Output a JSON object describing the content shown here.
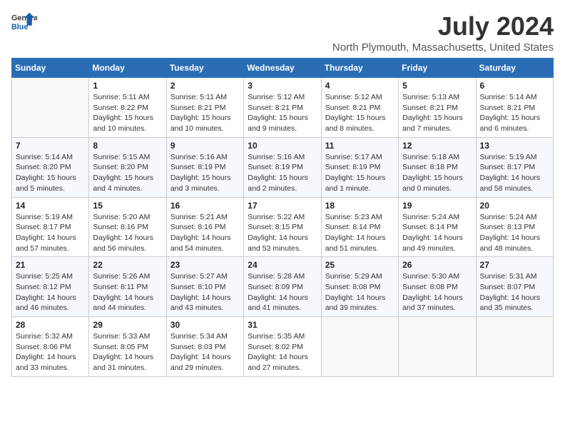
{
  "logo": {
    "line1": "General",
    "line2": "Blue"
  },
  "title": "July 2024",
  "subtitle": "North Plymouth, Massachusetts, United States",
  "weekdays": [
    "Sunday",
    "Monday",
    "Tuesday",
    "Wednesday",
    "Thursday",
    "Friday",
    "Saturday"
  ],
  "weeks": [
    [
      {
        "num": "",
        "sunrise": "",
        "sunset": "",
        "daylight": ""
      },
      {
        "num": "1",
        "sunrise": "Sunrise: 5:11 AM",
        "sunset": "Sunset: 8:22 PM",
        "daylight": "Daylight: 15 hours and 10 minutes."
      },
      {
        "num": "2",
        "sunrise": "Sunrise: 5:11 AM",
        "sunset": "Sunset: 8:21 PM",
        "daylight": "Daylight: 15 hours and 10 minutes."
      },
      {
        "num": "3",
        "sunrise": "Sunrise: 5:12 AM",
        "sunset": "Sunset: 8:21 PM",
        "daylight": "Daylight: 15 hours and 9 minutes."
      },
      {
        "num": "4",
        "sunrise": "Sunrise: 5:12 AM",
        "sunset": "Sunset: 8:21 PM",
        "daylight": "Daylight: 15 hours and 8 minutes."
      },
      {
        "num": "5",
        "sunrise": "Sunrise: 5:13 AM",
        "sunset": "Sunset: 8:21 PM",
        "daylight": "Daylight: 15 hours and 7 minutes."
      },
      {
        "num": "6",
        "sunrise": "Sunrise: 5:14 AM",
        "sunset": "Sunset: 8:21 PM",
        "daylight": "Daylight: 15 hours and 6 minutes."
      }
    ],
    [
      {
        "num": "7",
        "sunrise": "Sunrise: 5:14 AM",
        "sunset": "Sunset: 8:20 PM",
        "daylight": "Daylight: 15 hours and 5 minutes."
      },
      {
        "num": "8",
        "sunrise": "Sunrise: 5:15 AM",
        "sunset": "Sunset: 8:20 PM",
        "daylight": "Daylight: 15 hours and 4 minutes."
      },
      {
        "num": "9",
        "sunrise": "Sunrise: 5:16 AM",
        "sunset": "Sunset: 8:19 PM",
        "daylight": "Daylight: 15 hours and 3 minutes."
      },
      {
        "num": "10",
        "sunrise": "Sunrise: 5:16 AM",
        "sunset": "Sunset: 8:19 PM",
        "daylight": "Daylight: 15 hours and 2 minutes."
      },
      {
        "num": "11",
        "sunrise": "Sunrise: 5:17 AM",
        "sunset": "Sunset: 8:19 PM",
        "daylight": "Daylight: 15 hours and 1 minute."
      },
      {
        "num": "12",
        "sunrise": "Sunrise: 5:18 AM",
        "sunset": "Sunset: 8:18 PM",
        "daylight": "Daylight: 15 hours and 0 minutes."
      },
      {
        "num": "13",
        "sunrise": "Sunrise: 5:19 AM",
        "sunset": "Sunset: 8:17 PM",
        "daylight": "Daylight: 14 hours and 58 minutes."
      }
    ],
    [
      {
        "num": "14",
        "sunrise": "Sunrise: 5:19 AM",
        "sunset": "Sunset: 8:17 PM",
        "daylight": "Daylight: 14 hours and 57 minutes."
      },
      {
        "num": "15",
        "sunrise": "Sunrise: 5:20 AM",
        "sunset": "Sunset: 8:16 PM",
        "daylight": "Daylight: 14 hours and 56 minutes."
      },
      {
        "num": "16",
        "sunrise": "Sunrise: 5:21 AM",
        "sunset": "Sunset: 8:16 PM",
        "daylight": "Daylight: 14 hours and 54 minutes."
      },
      {
        "num": "17",
        "sunrise": "Sunrise: 5:22 AM",
        "sunset": "Sunset: 8:15 PM",
        "daylight": "Daylight: 14 hours and 53 minutes."
      },
      {
        "num": "18",
        "sunrise": "Sunrise: 5:23 AM",
        "sunset": "Sunset: 8:14 PM",
        "daylight": "Daylight: 14 hours and 51 minutes."
      },
      {
        "num": "19",
        "sunrise": "Sunrise: 5:24 AM",
        "sunset": "Sunset: 8:14 PM",
        "daylight": "Daylight: 14 hours and 49 minutes."
      },
      {
        "num": "20",
        "sunrise": "Sunrise: 5:24 AM",
        "sunset": "Sunset: 8:13 PM",
        "daylight": "Daylight: 14 hours and 48 minutes."
      }
    ],
    [
      {
        "num": "21",
        "sunrise": "Sunrise: 5:25 AM",
        "sunset": "Sunset: 8:12 PM",
        "daylight": "Daylight: 14 hours and 46 minutes."
      },
      {
        "num": "22",
        "sunrise": "Sunrise: 5:26 AM",
        "sunset": "Sunset: 8:11 PM",
        "daylight": "Daylight: 14 hours and 44 minutes."
      },
      {
        "num": "23",
        "sunrise": "Sunrise: 5:27 AM",
        "sunset": "Sunset: 8:10 PM",
        "daylight": "Daylight: 14 hours and 43 minutes."
      },
      {
        "num": "24",
        "sunrise": "Sunrise: 5:28 AM",
        "sunset": "Sunset: 8:09 PM",
        "daylight": "Daylight: 14 hours and 41 minutes."
      },
      {
        "num": "25",
        "sunrise": "Sunrise: 5:29 AM",
        "sunset": "Sunset: 8:08 PM",
        "daylight": "Daylight: 14 hours and 39 minutes."
      },
      {
        "num": "26",
        "sunrise": "Sunrise: 5:30 AM",
        "sunset": "Sunset: 8:08 PM",
        "daylight": "Daylight: 14 hours and 37 minutes."
      },
      {
        "num": "27",
        "sunrise": "Sunrise: 5:31 AM",
        "sunset": "Sunset: 8:07 PM",
        "daylight": "Daylight: 14 hours and 35 minutes."
      }
    ],
    [
      {
        "num": "28",
        "sunrise": "Sunrise: 5:32 AM",
        "sunset": "Sunset: 8:06 PM",
        "daylight": "Daylight: 14 hours and 33 minutes."
      },
      {
        "num": "29",
        "sunrise": "Sunrise: 5:33 AM",
        "sunset": "Sunset: 8:05 PM",
        "daylight": "Daylight: 14 hours and 31 minutes."
      },
      {
        "num": "30",
        "sunrise": "Sunrise: 5:34 AM",
        "sunset": "Sunset: 8:03 PM",
        "daylight": "Daylight: 14 hours and 29 minutes."
      },
      {
        "num": "31",
        "sunrise": "Sunrise: 5:35 AM",
        "sunset": "Sunset: 8:02 PM",
        "daylight": "Daylight: 14 hours and 27 minutes."
      },
      {
        "num": "",
        "sunrise": "",
        "sunset": "",
        "daylight": ""
      },
      {
        "num": "",
        "sunrise": "",
        "sunset": "",
        "daylight": ""
      },
      {
        "num": "",
        "sunrise": "",
        "sunset": "",
        "daylight": ""
      }
    ]
  ]
}
